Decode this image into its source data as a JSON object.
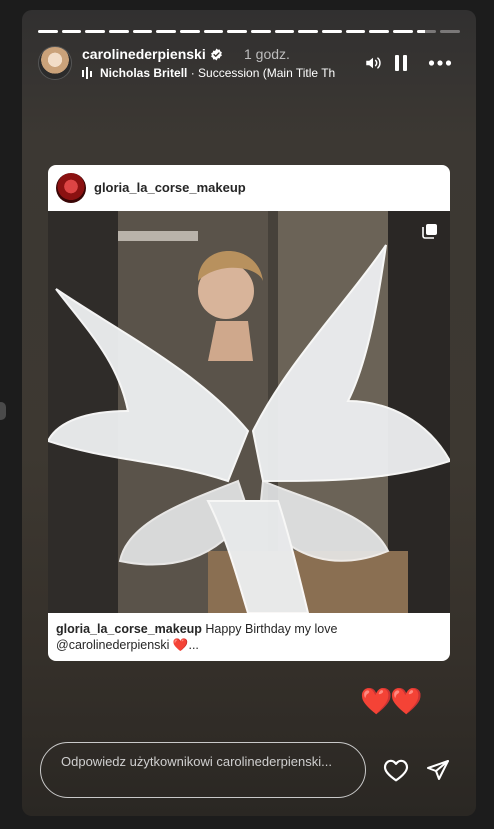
{
  "story": {
    "segments": [
      1,
      1,
      1,
      1,
      1,
      1,
      1,
      1,
      1,
      1,
      1,
      1,
      1,
      1,
      1,
      1,
      0.4,
      0
    ],
    "user": {
      "username": "carolinederpienski",
      "time": "1 godz."
    },
    "music": {
      "artist": "Nicholas Britell",
      "separator": " · ",
      "title": "Succession (Main Title Th"
    },
    "icons": {
      "sound": "speaker-icon",
      "pause": "pause-icon",
      "more": "more-icon",
      "verified": "verified-badge-icon",
      "music": "music-bars-icon"
    }
  },
  "post": {
    "username": "gloria_la_corse_makeup",
    "caption_user": "gloria_la_corse_makeup",
    "caption_text": " Happy Birthday my love @carolinederpienski ❤️...",
    "icons": {
      "multi": "multiple-images-icon"
    }
  },
  "reactions": {
    "hearts": "❤️❤️"
  },
  "reply": {
    "placeholder": "Odpowiedz użytkownikowi carolinederpienski..."
  },
  "colors": {
    "accent_heart": "#e0242e",
    "text_white": "#ffffff"
  }
}
